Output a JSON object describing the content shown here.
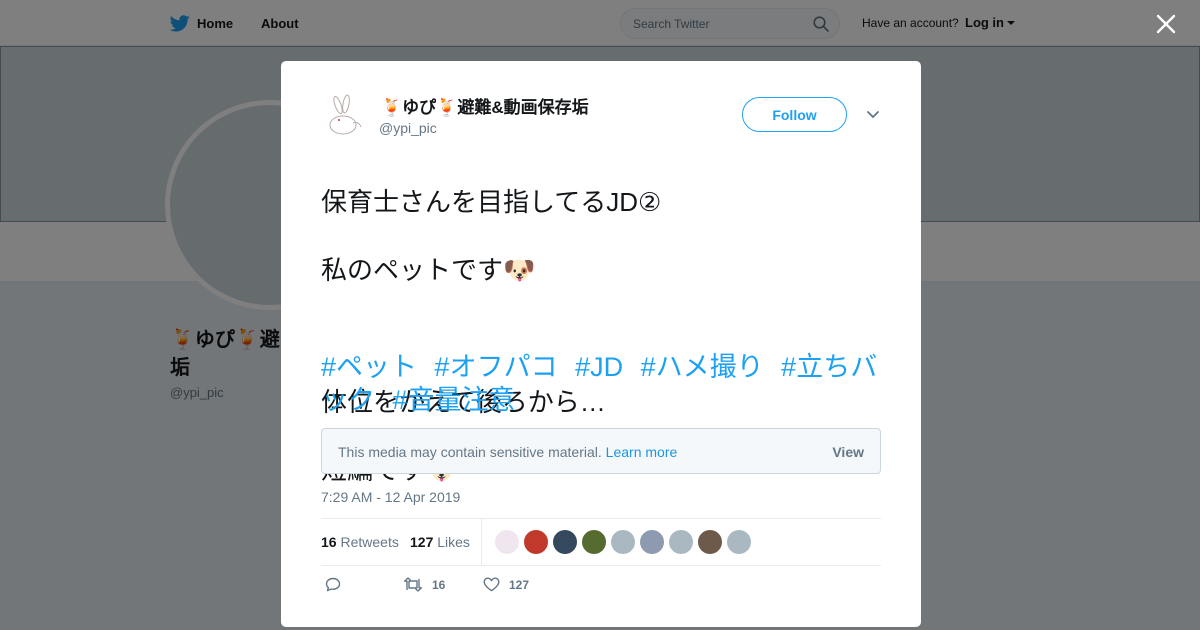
{
  "topbar": {
    "home_label": "Home",
    "about_label": "About",
    "search_placeholder": "Search Twitter",
    "account_question": "Have an account?",
    "login_label": "Log in"
  },
  "profile": {
    "name": "🍹ゆぴ🍹避難&動画保存垢",
    "name_visible": "🍹ゆぴ🍹避\n垢",
    "handle": "@ypi_pic"
  },
  "tweet": {
    "author_name": "🍹ゆぴ🍹避難&動画保存垢",
    "author_handle": "@ypi_pic",
    "follow_label": "Follow",
    "lines": [
      "保育士さんを目指してるJD②",
      "私のペットです🐶",
      "体位をかえて後ろから…",
      "短編です🐶"
    ],
    "hashtags": [
      "#ペット",
      "#オフパコ",
      "#JD",
      "#ハメ撮り",
      "#立ちバック",
      "#音量注意"
    ],
    "sensitive_message": "This media may contain sensitive material.",
    "learn_more_label": "Learn more",
    "view_label": "View",
    "timestamp": "7:29 AM - 12 Apr 2019",
    "retweet_count": "16",
    "retweets_label": "Retweets",
    "like_count": "127",
    "likes_label": "Likes",
    "action_retweet_count": "16",
    "action_like_count": "127"
  },
  "liker_avatar_colors": [
    "#f0e6f0",
    "#c0392b",
    "#34495e",
    "#556b2f",
    "#aab8c2",
    "#8e9aaf",
    "#aab8c2",
    "#6d5a4b",
    "#aab8c2"
  ],
  "colors": {
    "accent": "#1da1f2",
    "twitter_blue": "#1da1f2",
    "text_primary": "#14171a",
    "text_secondary": "#657786"
  }
}
